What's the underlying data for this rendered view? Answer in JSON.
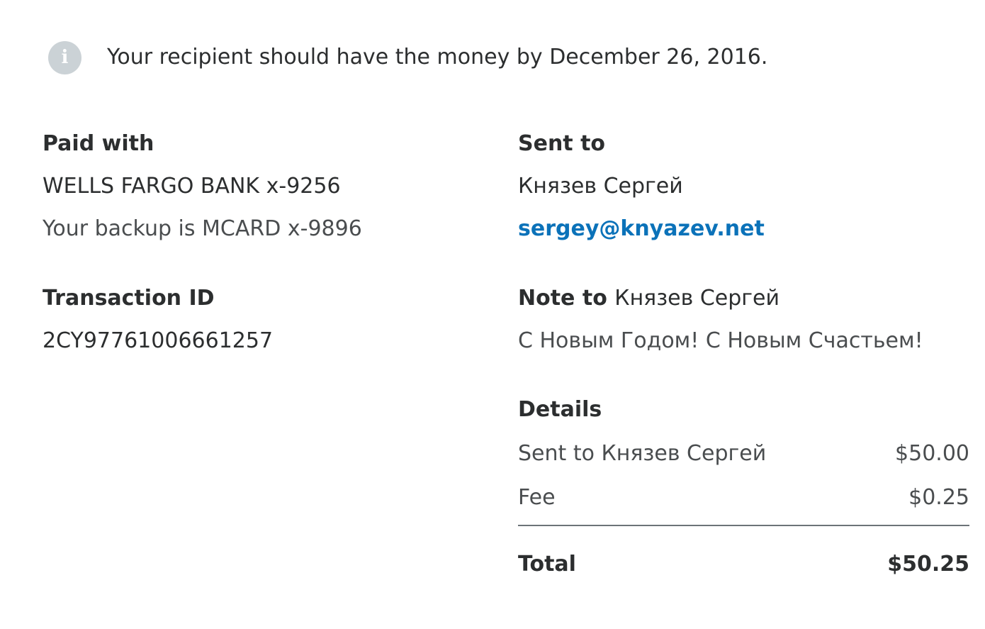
{
  "notice": {
    "icon": "info-icon",
    "icon_glyph": "i",
    "text": "Your recipient should have the money by December 26, 2016."
  },
  "payment": {
    "heading": "Paid with",
    "source": "WELLS FARGO BANK x-9256",
    "backup": "Your backup is MCARD x-9896"
  },
  "transaction": {
    "heading": "Transaction ID",
    "id": "2CY97761006661257"
  },
  "recipient": {
    "heading": "Sent to",
    "name": "Князев Сергей",
    "email": "sergey@knyazev.net"
  },
  "note": {
    "heading_prefix": "Note to",
    "heading_name": "Князев Сергей",
    "text": "С Новым Годом! С Новым Счастьем!"
  },
  "details": {
    "heading": "Details",
    "rows": [
      {
        "label": "Sent to Князев Сергей",
        "amount": "$50.00"
      },
      {
        "label": "Fee",
        "amount": "$0.25"
      }
    ],
    "total": {
      "label": "Total",
      "amount": "$50.25"
    }
  },
  "colors": {
    "link": "#0b72b9",
    "icon_bg": "#cbd2d6",
    "text": "#2c2e2f",
    "muted": "#4a4d4f",
    "divider": "#6c7378"
  }
}
